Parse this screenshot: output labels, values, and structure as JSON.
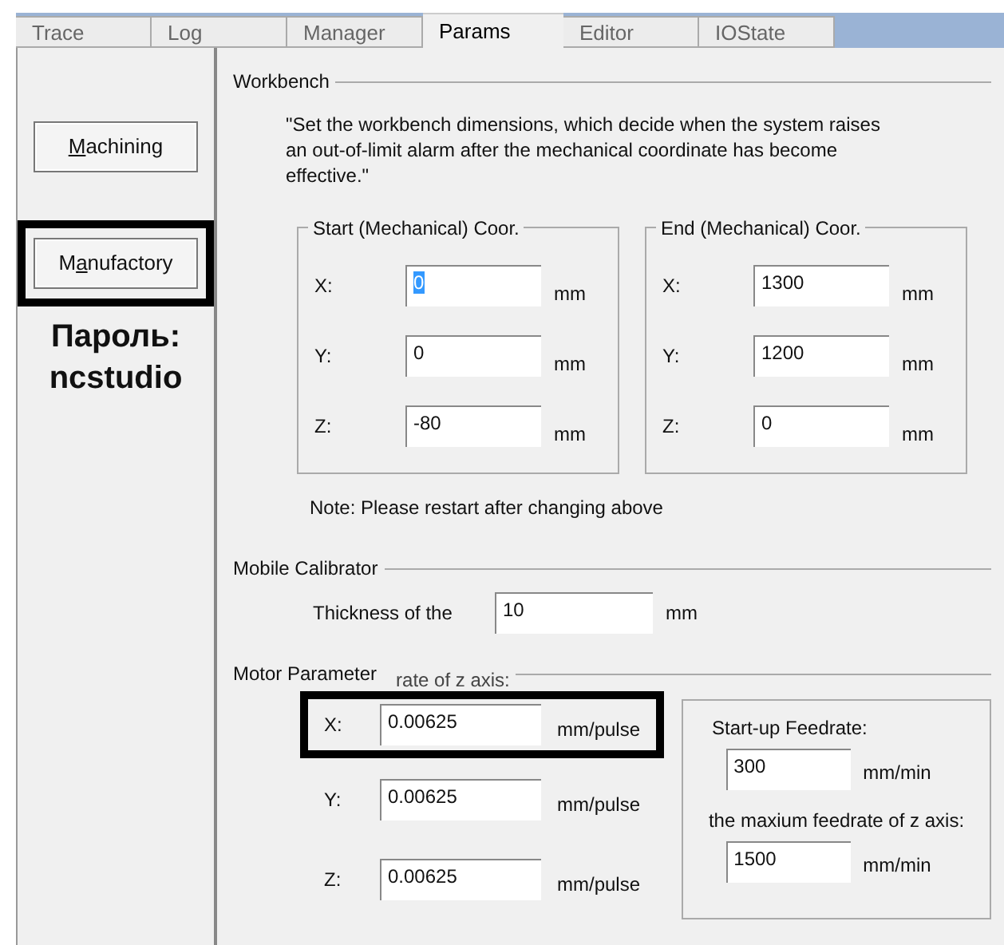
{
  "tabs": [
    {
      "label": "Trace",
      "selected": false
    },
    {
      "label": "Log",
      "selected": false
    },
    {
      "label": "Manager",
      "selected": false
    },
    {
      "label": "Params",
      "selected": true
    },
    {
      "label": "Editor",
      "selected": false
    },
    {
      "label": "IOState",
      "selected": false
    }
  ],
  "sidebar": {
    "buttons": [
      {
        "access_key": "M",
        "rest": "achining",
        "highlighted": false
      },
      {
        "before": "M",
        "access_key": "a",
        "rest": "nufactory",
        "highlighted": true
      }
    ],
    "note_lines": [
      "Пароль:",
      "ncstudio"
    ]
  },
  "workbench": {
    "title": "Workbench",
    "description": "\"Set the workbench dimensions, which decide when the system raises an out-of-limit alarm after the mechanical coordinate has become effective.\"",
    "groups": [
      {
        "title": "Start (Mechanical) Coor.",
        "fields": [
          {
            "label": "X:",
            "value": "0",
            "text_selected": true,
            "unit": "mm"
          },
          {
            "label": "Y:",
            "value": "0",
            "text_selected": false,
            "unit": "mm"
          },
          {
            "label": "Z:",
            "value": "-80",
            "text_selected": false,
            "unit": "mm"
          }
        ]
      },
      {
        "title": "End (Mechanical) Coor.",
        "fields": [
          {
            "label": "X:",
            "value": "1300",
            "text_selected": false,
            "unit": "mm"
          },
          {
            "label": "Y:",
            "value": "1200",
            "text_selected": false,
            "unit": "mm"
          },
          {
            "label": "Z:",
            "value": "0",
            "text_selected": false,
            "unit": "mm"
          }
        ]
      }
    ],
    "note": "Note: Please restart after changing above"
  },
  "mobile_calibrator": {
    "title": "Mobile Calibrator",
    "label": "Thickness of the",
    "value": "10",
    "unit": "mm"
  },
  "motor_parameter": {
    "title": "Motor Parameter",
    "overlapping_text": "rate of z axis:",
    "fields": [
      {
        "label": "X:",
        "value": "0.00625",
        "unit": "mm/pulse",
        "highlighted": true
      },
      {
        "label": "Y:",
        "value": "0.00625",
        "unit": "mm/pulse",
        "highlighted": false
      },
      {
        "label": "Z:",
        "value": "0.00625",
        "unit": "mm/pulse",
        "highlighted": false
      }
    ],
    "feedrates": [
      {
        "label": "Start-up Feedrate:",
        "value": "300",
        "unit": "mm/min"
      },
      {
        "label": "the maxium feedrate of z axis:",
        "value": "1500",
        "unit": "mm/min"
      }
    ]
  }
}
